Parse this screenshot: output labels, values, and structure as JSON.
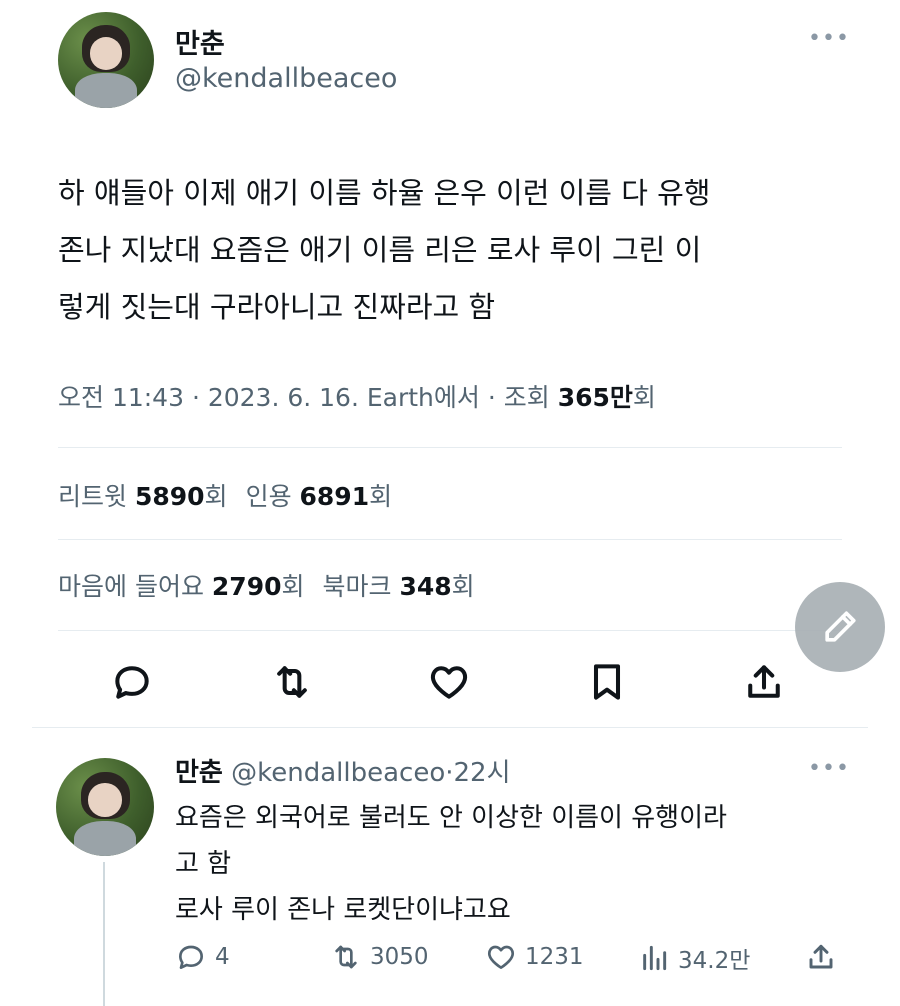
{
  "tweet": {
    "author_name": "만춘",
    "author_handle": "@kendallbeaceo",
    "more_icon": "more-dots-icon",
    "text_lines": [
      "하 얘들아 이제 애기 이름 하율 은우 이런 이름 다 유행",
      "존나 지났대 요즘은 애기 이름 리은 로사 루이 그린 이",
      "렇게 짓는대 구라아니고 진짜라고 함"
    ],
    "meta_prefix": "오전 11:43 · 2023. 6. 16. Earth에서 · 조회 ",
    "views_num": "365만",
    "views_suffix": "회"
  },
  "stats": {
    "retweets_label": "리트윗 ",
    "retweets_num": "5890",
    "retweets_unit": "회",
    "quotes_label": "인용 ",
    "quotes_num": "6891",
    "quotes_unit": "회",
    "likes_label": "마음에 들어요 ",
    "likes_num": "2790",
    "likes_unit": "회",
    "bookmarks_label": "북마크 ",
    "bookmarks_num": "348",
    "bookmarks_unit": "회"
  },
  "actions": [
    "reply-icon",
    "retweet-icon",
    "like-icon",
    "bookmark-icon",
    "share-icon"
  ],
  "reply": {
    "author_name": "만춘",
    "author_handle": "@kendallbeaceo",
    "time": "·22시",
    "text_lines": [
      "요즘은 외국어로 불러도 안 이상한 이름이 유행이라",
      "고 함",
      "로사 루이 존나 로켓단이냐고요"
    ],
    "replies": "4",
    "retweets": "3050",
    "likes": "1231",
    "views": "34.2만"
  },
  "colors": {
    "text": "#0f1419",
    "secondary": "#536471",
    "divider": "#e6ecf0",
    "fab": "#a9b0b5"
  }
}
